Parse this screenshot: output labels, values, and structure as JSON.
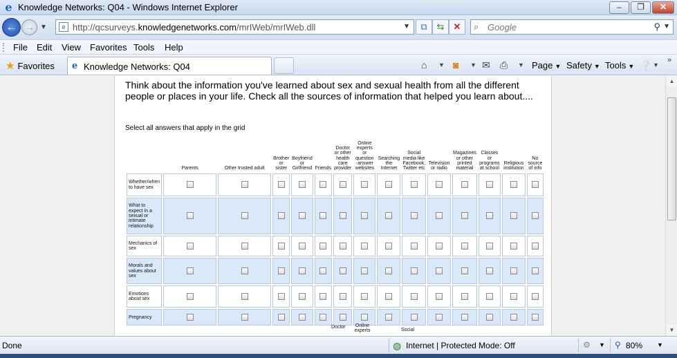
{
  "window": {
    "title": "Knowledge Networks: Q04 - Windows Internet Explorer",
    "minimize": "–",
    "maximize": "❐",
    "close": "✕"
  },
  "nav": {
    "url_prefix": "http://qcsurveys.",
    "url_domain": "knowledgenetworks.com",
    "url_path": "/mrIWeb/mrIWeb.dll",
    "search_placeholder": "Google"
  },
  "menu": {
    "items": [
      "File",
      "Edit",
      "View",
      "Favorites",
      "Tools",
      "Help"
    ]
  },
  "tabs": {
    "favorites_label": "Favorites",
    "active_tab_label": "Knowledge Networks: Q04"
  },
  "commandbar": {
    "page": "Page",
    "safety": "Safety",
    "tools": "Tools"
  },
  "survey": {
    "question": "Think about the information you've learned about sex and sexual health from all the different people or places in your life. Check all the sources of information that helped you learn about....",
    "instruction": "Select all answers that apply in the grid",
    "columns": [
      "Parents",
      "Other trusted adult",
      "Brother or sister",
      "Boyfriend or Girlfriend",
      "Friends",
      "Doctor or other health care provider",
      "Online experts or question -answer websites",
      "Searching the Internet",
      "Social media like Facebook, Twitter etc",
      "Television or radio",
      "Magazines or other printed material",
      "Classes or programs at school",
      "Religious institution",
      "No source of info"
    ],
    "rows": [
      "Whether/when to have sex",
      "What to expect in a sexual or intimate relationship",
      "Mechanics of sex",
      "Morals and values about sex",
      "Emotions about sex",
      "Pregnancy"
    ],
    "next_header_partial": [
      "Doctor",
      "Online experts",
      "Social"
    ]
  },
  "status": {
    "left": "Done",
    "zone": "Internet | Protected Mode: Off",
    "zoom": "80%"
  }
}
